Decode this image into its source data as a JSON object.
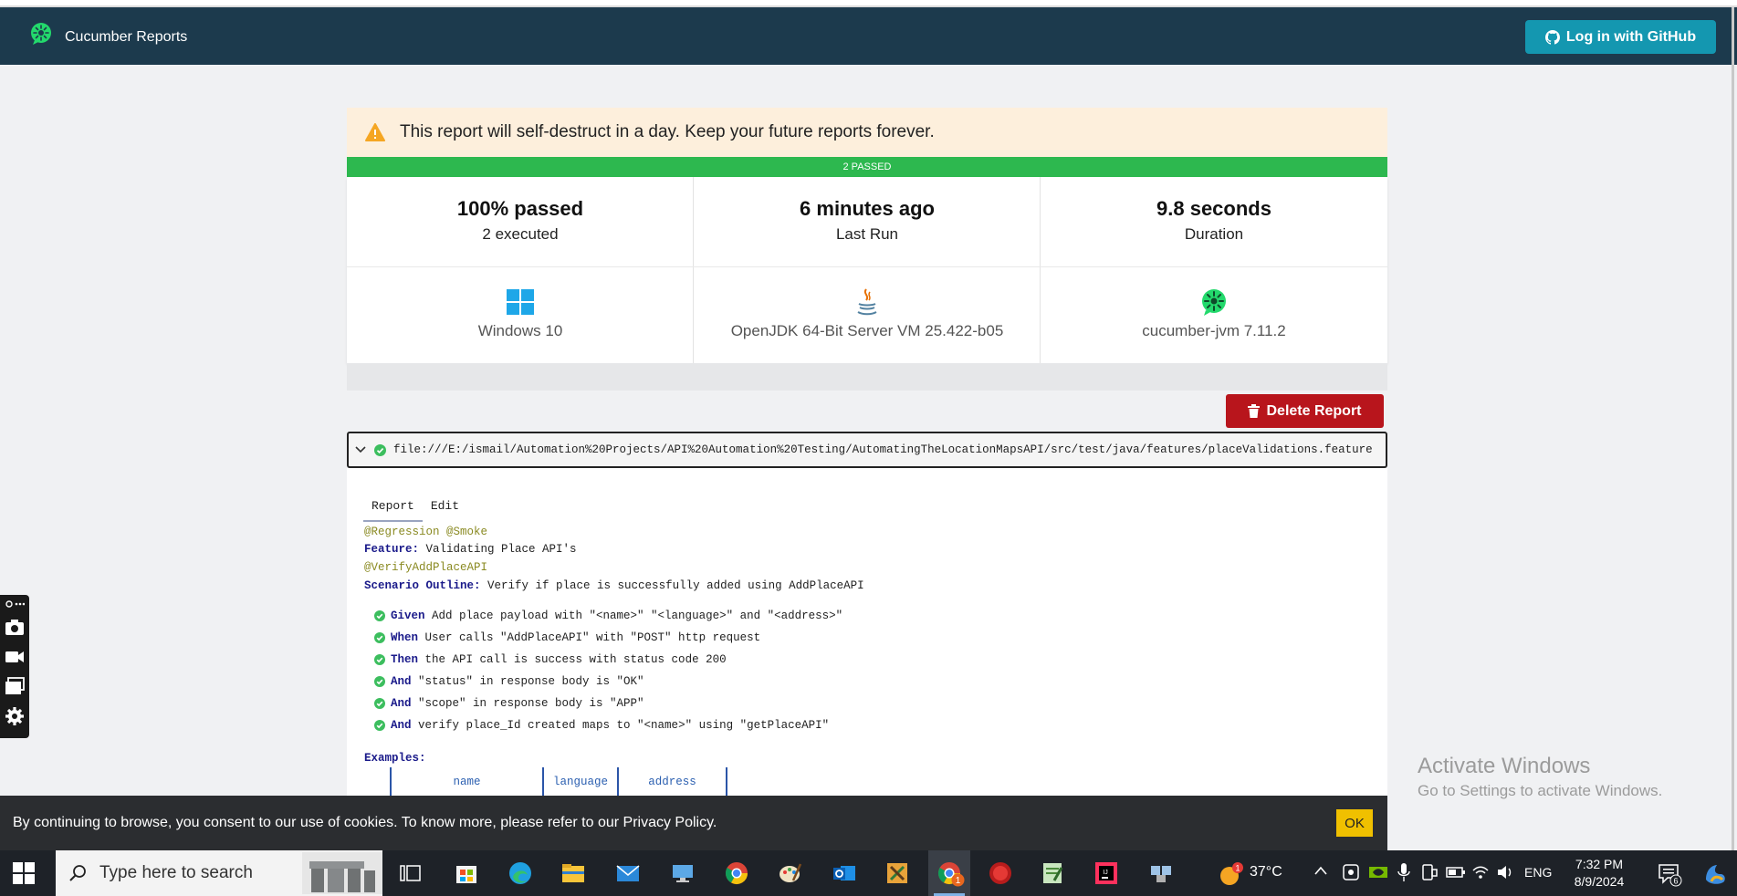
{
  "navbar": {
    "brand": "Cucumber Reports",
    "login_button": "Log in with GitHub"
  },
  "notice": {
    "text": "This report will self-destruct in a day. Keep your future reports forever."
  },
  "summary_bar": "2 PASSED",
  "stats": {
    "passed": {
      "value": "100% passed",
      "label": "2 executed"
    },
    "last_run": {
      "value": "6 minutes ago",
      "label": "Last Run"
    },
    "duration": {
      "value": "9.8 seconds",
      "label": "Duration"
    }
  },
  "environment": {
    "os": "Windows 10",
    "jvm": "OpenJDK 64-Bit Server VM 25.422-b05",
    "tool": "cucumber-jvm 7.11.2"
  },
  "delete_button": "Delete Report",
  "feature_file": "file:///E:/ismail/Automation%20Projects/API%20Automation%20Testing/AutomatingTheLocationMapsAPI/src/test/java/features/placeValidations.feature",
  "tabs": [
    "Report",
    "Edit"
  ],
  "gherkin": {
    "feature_tags": "@Regression @Smoke",
    "feature_keyword": "Feature:",
    "feature_name": " Validating Place API's",
    "scenario_tags": "@VerifyAddPlaceAPI",
    "scenario_keyword": "Scenario Outline:",
    "scenario_name": " Verify if place is successfully added using AddPlaceAPI",
    "steps": [
      {
        "keyword": "Given",
        "text": " Add place payload with \"<name>\" \"<language>\" and \"<address>\""
      },
      {
        "keyword": "When",
        "text": " User calls \"AddPlaceAPI\" with \"POST\" http request"
      },
      {
        "keyword": "Then",
        "text": " the API call is success with status code 200"
      },
      {
        "keyword": "And",
        "text": " \"status\" in response body is \"OK\""
      },
      {
        "keyword": "And",
        "text": " \"scope\" in response body is \"APP\""
      },
      {
        "keyword": "And",
        "text": " verify place_Id created maps to \"<name>\" using \"getPlaceAPI\""
      }
    ],
    "examples_keyword": "Examples:",
    "examples_headers": [
      "name",
      "language",
      "address"
    ]
  },
  "watermark": {
    "line1": "Activate Windows",
    "line2": "Go to Settings to activate Windows."
  },
  "cookie": {
    "text": "By continuing to browse, you consent to our use of cookies. To know more, please refer to our Privacy Policy.",
    "ok": "OK"
  },
  "taskbar": {
    "search_placeholder": "Type here to search",
    "weather": "37°C",
    "weather_badge": "1",
    "chrome_badge": "1",
    "language": "ENG",
    "time": "7:32 PM",
    "date": "8/9/2024",
    "notifications": "6"
  }
}
